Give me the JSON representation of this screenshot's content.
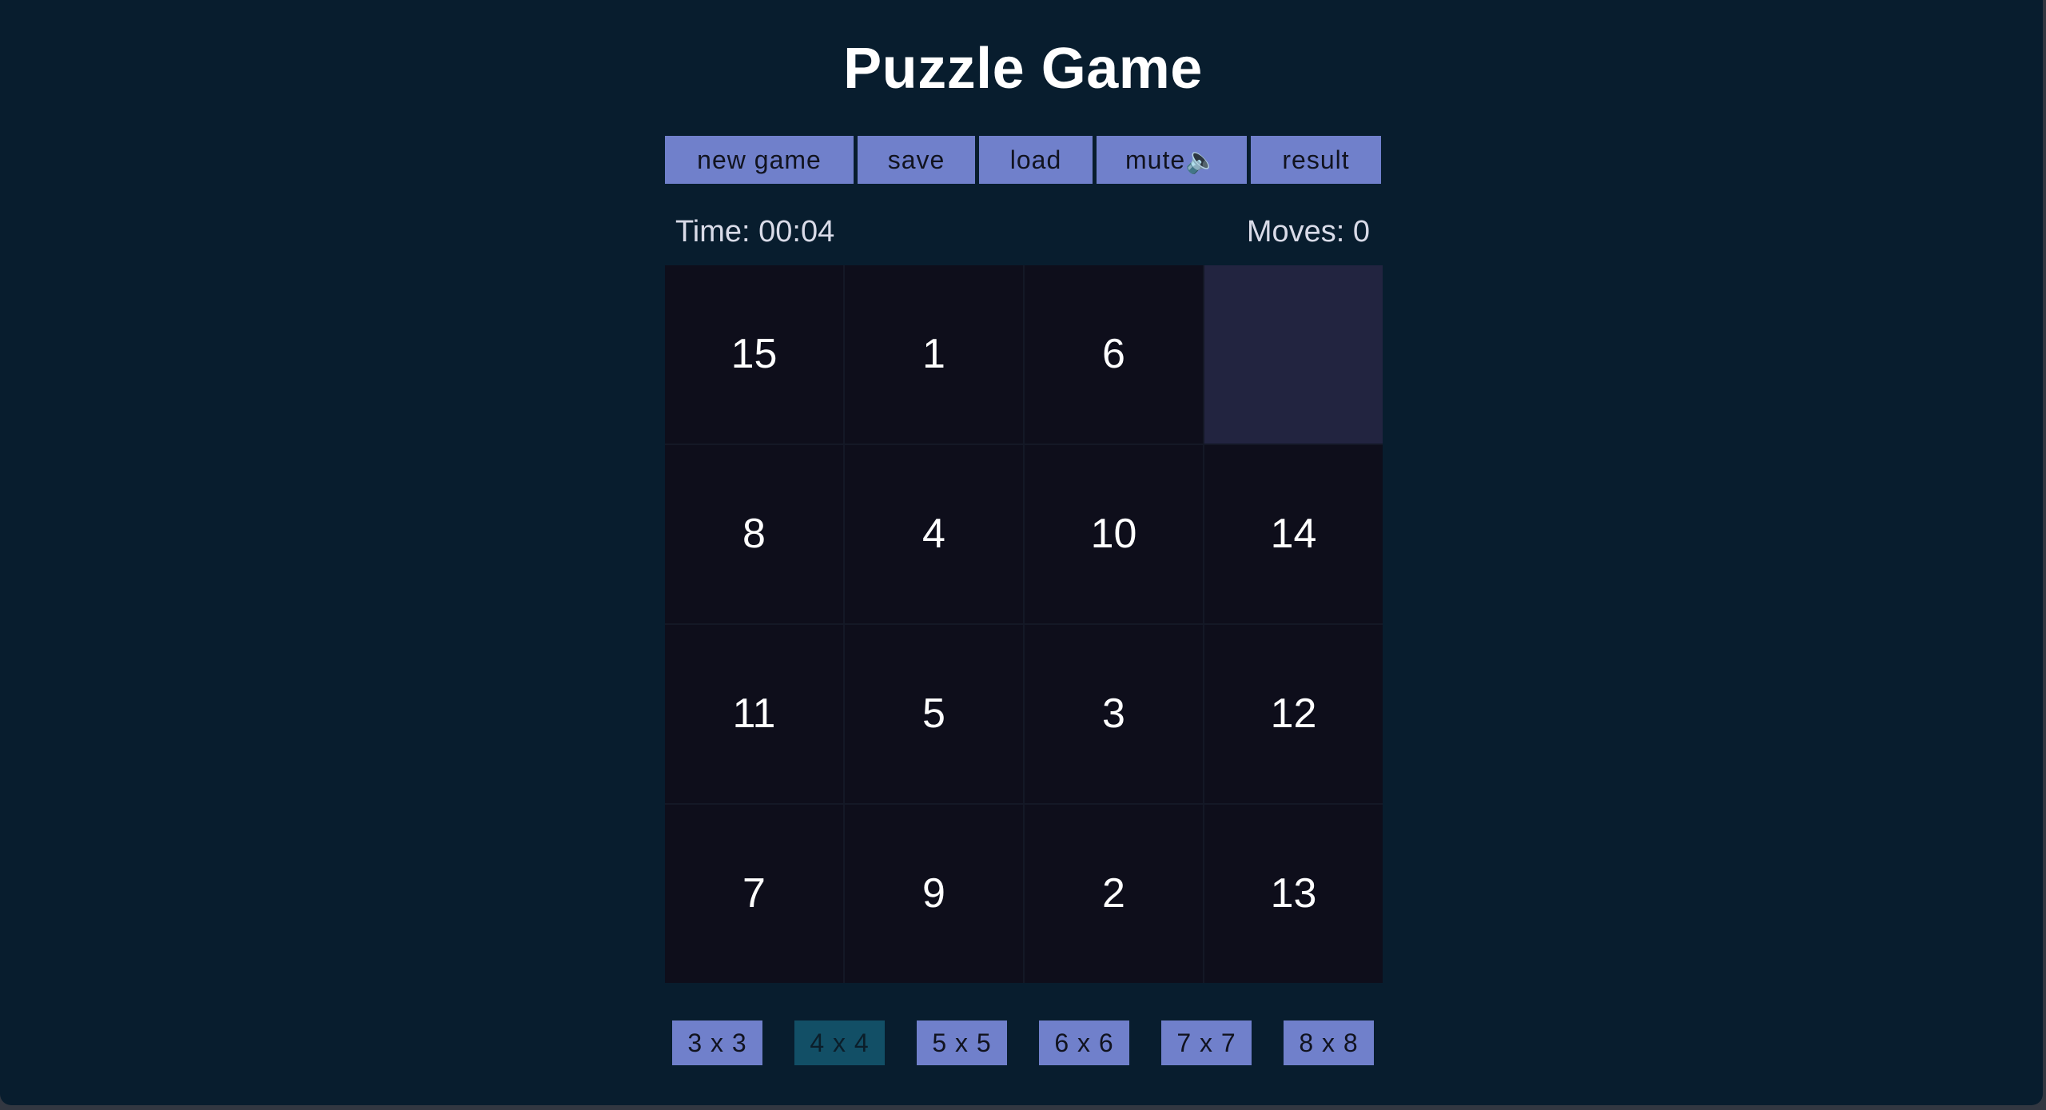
{
  "title": "Puzzle Game",
  "toolbar": {
    "new_game": "new game",
    "save": "save",
    "load": "load",
    "mute": "mute🔈",
    "result": "result"
  },
  "status": {
    "time": "Time: 00:04",
    "moves": "Moves: 0"
  },
  "board": {
    "size": 4,
    "tiles": [
      "15",
      "1",
      "6",
      "",
      "8",
      "4",
      "10",
      "14",
      "11",
      "5",
      "3",
      "12",
      "7",
      "9",
      "2",
      "13"
    ]
  },
  "sizes": {
    "options": [
      "3 x 3",
      "4 x 4",
      "5 x 5",
      "6 x 6",
      "7 x 7",
      "8 x 8"
    ],
    "active": "4 x 4"
  },
  "colors": {
    "background": "#081d2e",
    "button": "#7080cb",
    "active_size": "#124f66",
    "tile": "#0e0e1b",
    "empty_tile": "#222440"
  }
}
